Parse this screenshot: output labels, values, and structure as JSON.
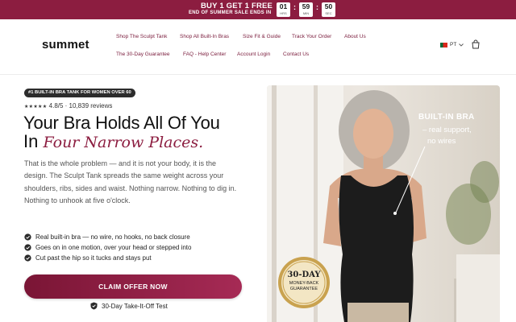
{
  "promo": {
    "headline": "BUY 1 GET 1 FREE",
    "subline": "END OF SUMMER SALE ENDS IN",
    "timer": [
      {
        "value": "01",
        "unit": "HRS"
      },
      {
        "value": "59",
        "unit": "MIN"
      },
      {
        "value": "50",
        "unit": "SEC"
      }
    ]
  },
  "header": {
    "logo": "summet",
    "nav": [
      "Shop The Sculpt Tank",
      "Shop All Built-In Bras",
      "Size Fit & Guide",
      "Track Your Order",
      "About Us",
      "The 30-Day Guarantee",
      "FAQ - Help Center",
      "Account Login",
      "Contact Us"
    ],
    "language": "PT"
  },
  "hero": {
    "badge": "#1 BUILT-IN BRA TANK FOR WOMEN OVER 60",
    "stars": "★★★★★",
    "rating": "4.8/5 · 10,839 reviews",
    "headline_line1": "Your Bra Holds All Of You",
    "headline_line2_prefix": "In",
    "headline_line2_accent": "Four Narrow Places.",
    "body": "That is the whole problem — and it is not your body, it is the design. The Sculpt Tank spreads the same weight across your shoulders, ribs, sides and waist. Nothing narrow. Nothing to dig in. Nothing to unhook at five o'clock.",
    "bullets": [
      "Real built-in bra — no wire, no hooks, no back closure",
      "Goes on in one motion, over your head or stepped into",
      "Cut past the hip so it tucks and stays put"
    ],
    "cta": "CLAIM OFFER NOW",
    "guarantee": "30-Day Take-It-Off Test"
  },
  "photo": {
    "overlay_title": "BUILT-IN BRA",
    "overlay_line2": "– real support,",
    "overlay_line3": "no wires",
    "seal_big": "30-DAY",
    "seal_line2": "MONEY-BACK",
    "seal_line3": "GUARANTEE"
  },
  "colors": {
    "brand": "#8c1d40",
    "cta": "#a62a55",
    "promo_bg": "#8c1d40"
  }
}
